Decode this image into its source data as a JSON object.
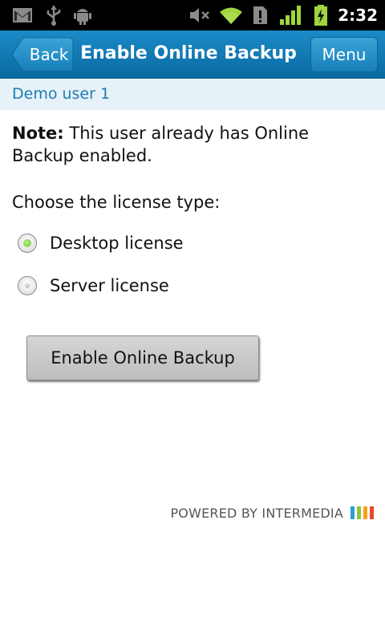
{
  "status_bar": {
    "time": "2:32",
    "icons": [
      "gmail-icon",
      "usb-icon",
      "android-debug-icon",
      "mute-icon",
      "wifi-icon",
      "sim-alert-icon",
      "signal-icon",
      "battery-charging-icon"
    ],
    "icon_color": "#9fd53f"
  },
  "header": {
    "back_label": "Back",
    "title": "Enable Online Backup",
    "menu_label": "Menu",
    "color": "#1279b5"
  },
  "subheader": {
    "user": "Demo user 1"
  },
  "content": {
    "note_label": "Note:",
    "note_text": " This user already has Online Backup enabled.",
    "choose_label": "Choose the license type:",
    "options": [
      {
        "label": "Desktop license",
        "selected": true
      },
      {
        "label": "Server license",
        "selected": false
      }
    ],
    "selected_color": "#6cc33d",
    "submit_label": "Enable Online Backup"
  },
  "footer": {
    "powered_by": "POWERED BY INTERMEDIA",
    "logo_colors": [
      "#2a9fd8",
      "#8cc63e",
      "#f5a21c",
      "#e84a2e"
    ]
  }
}
